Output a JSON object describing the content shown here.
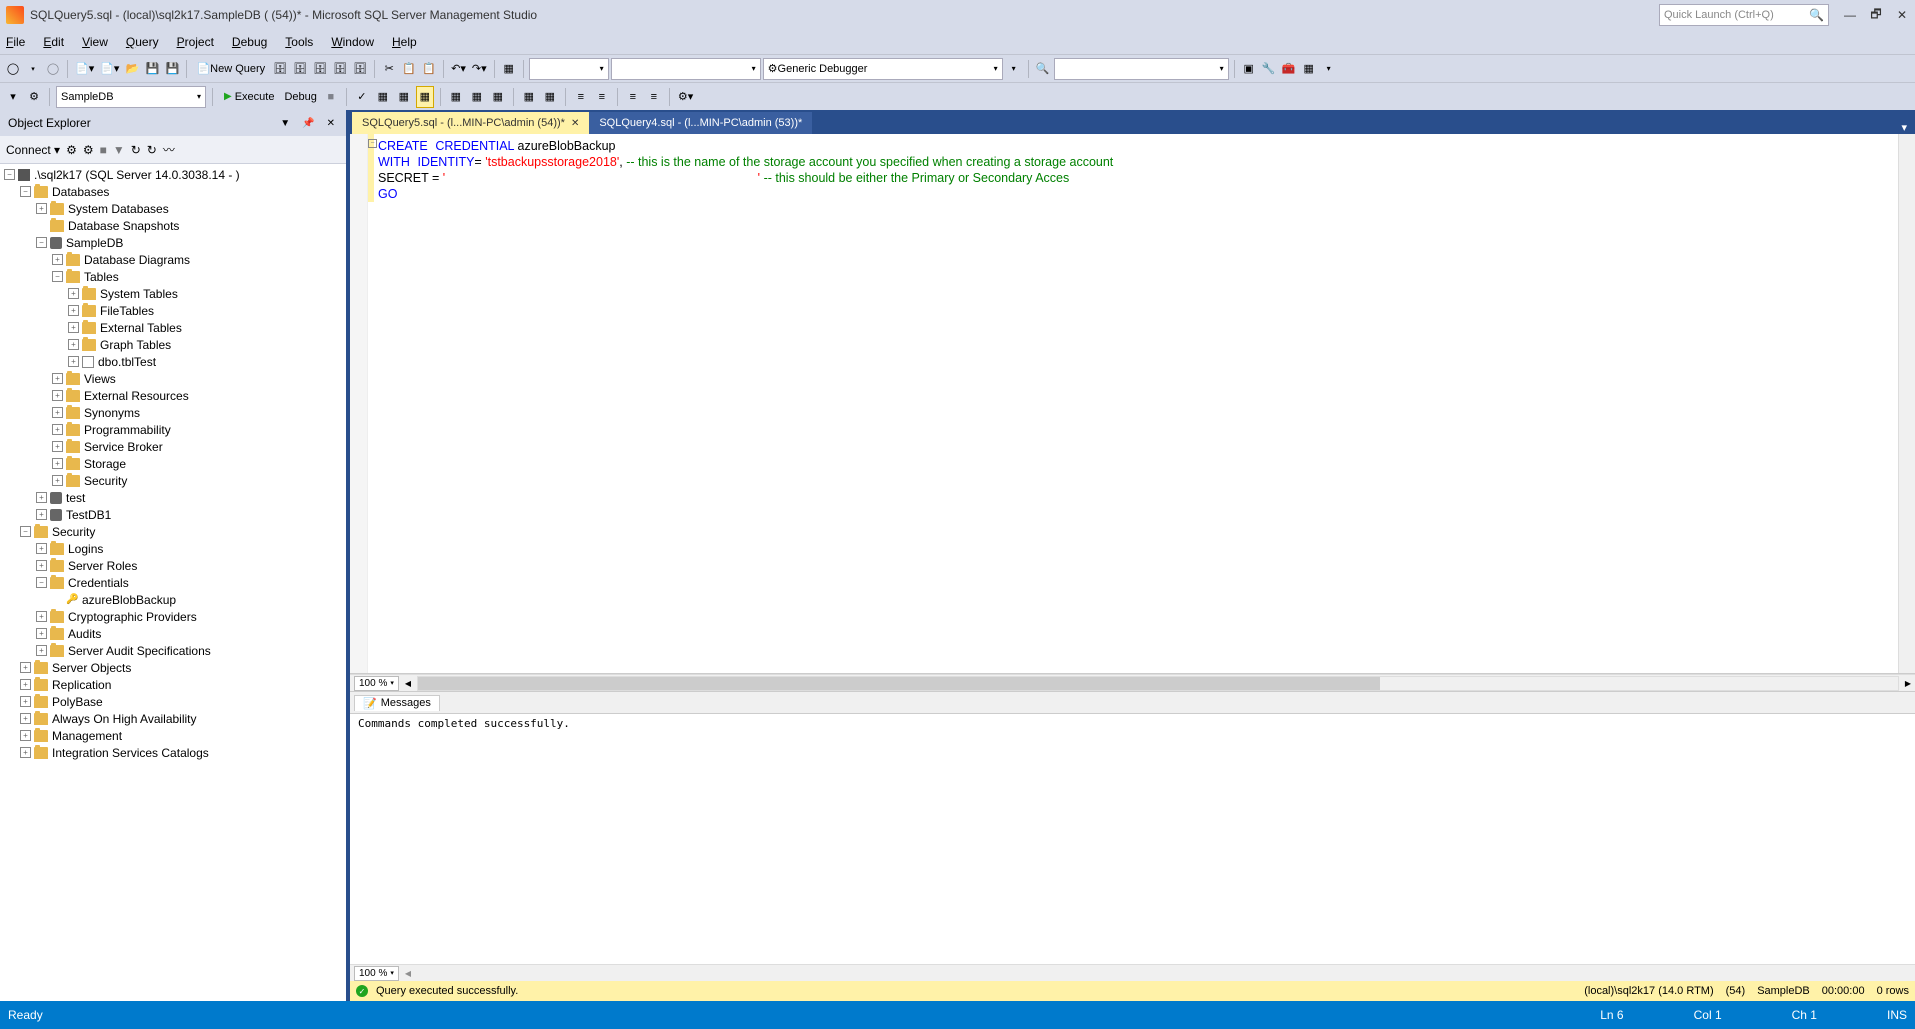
{
  "titlebar": {
    "title": "SQLQuery5.sql - (local)\\sql2k17.SampleDB (           (54))* - Microsoft SQL Server Management Studio",
    "quick_launch_placeholder": "Quick Launch (Ctrl+Q)"
  },
  "menubar": [
    "File",
    "Edit",
    "View",
    "Query",
    "Project",
    "Debug",
    "Tools",
    "Window",
    "Help"
  ],
  "toolbar1": {
    "new_query": "New Query",
    "debugger_combo": "Generic Debugger"
  },
  "toolbar2": {
    "db_combo": "SampleDB",
    "execute": "Execute",
    "debug": "Debug"
  },
  "object_explorer": {
    "title": "Object Explorer",
    "connect": "Connect",
    "root": ".\\sql2k17 (SQL Server 14.0.3038.14 -                        )",
    "tree": [
      {
        "d": 1,
        "t": "-",
        "i": "folder",
        "l": "Databases"
      },
      {
        "d": 2,
        "t": "+",
        "i": "folder",
        "l": "System Databases"
      },
      {
        "d": 2,
        "t": " ",
        "i": "folder",
        "l": "Database Snapshots"
      },
      {
        "d": 2,
        "t": "-",
        "i": "db",
        "l": "SampleDB"
      },
      {
        "d": 3,
        "t": "+",
        "i": "folder",
        "l": "Database Diagrams"
      },
      {
        "d": 3,
        "t": "-",
        "i": "folder",
        "l": "Tables"
      },
      {
        "d": 4,
        "t": "+",
        "i": "folder",
        "l": "System Tables"
      },
      {
        "d": 4,
        "t": "+",
        "i": "folder",
        "l": "FileTables"
      },
      {
        "d": 4,
        "t": "+",
        "i": "folder",
        "l": "External Tables"
      },
      {
        "d": 4,
        "t": "+",
        "i": "folder",
        "l": "Graph Tables"
      },
      {
        "d": 4,
        "t": "+",
        "i": "table",
        "l": "dbo.tblTest"
      },
      {
        "d": 3,
        "t": "+",
        "i": "folder",
        "l": "Views"
      },
      {
        "d": 3,
        "t": "+",
        "i": "folder",
        "l": "External Resources"
      },
      {
        "d": 3,
        "t": "+",
        "i": "folder",
        "l": "Synonyms"
      },
      {
        "d": 3,
        "t": "+",
        "i": "folder",
        "l": "Programmability"
      },
      {
        "d": 3,
        "t": "+",
        "i": "folder",
        "l": "Service Broker"
      },
      {
        "d": 3,
        "t": "+",
        "i": "folder",
        "l": "Storage"
      },
      {
        "d": 3,
        "t": "+",
        "i": "folder",
        "l": "Security"
      },
      {
        "d": 2,
        "t": "+",
        "i": "db",
        "l": "test"
      },
      {
        "d": 2,
        "t": "+",
        "i": "db",
        "l": "TestDB1"
      },
      {
        "d": 1,
        "t": "-",
        "i": "folder",
        "l": "Security"
      },
      {
        "d": 2,
        "t": "+",
        "i": "folder",
        "l": "Logins"
      },
      {
        "d": 2,
        "t": "+",
        "i": "folder",
        "l": "Server Roles"
      },
      {
        "d": 2,
        "t": "-",
        "i": "folder",
        "l": "Credentials"
      },
      {
        "d": 3,
        "t": " ",
        "i": "key",
        "l": "azureBlobBackup"
      },
      {
        "d": 2,
        "t": "+",
        "i": "folder",
        "l": "Cryptographic Providers"
      },
      {
        "d": 2,
        "t": "+",
        "i": "folder",
        "l": "Audits"
      },
      {
        "d": 2,
        "t": "+",
        "i": "folder",
        "l": "Server Audit Specifications"
      },
      {
        "d": 1,
        "t": "+",
        "i": "folder",
        "l": "Server Objects"
      },
      {
        "d": 1,
        "t": "+",
        "i": "folder",
        "l": "Replication"
      },
      {
        "d": 1,
        "t": "+",
        "i": "folder",
        "l": "PolyBase"
      },
      {
        "d": 1,
        "t": "+",
        "i": "folder",
        "l": "Always On High Availability"
      },
      {
        "d": 1,
        "t": "+",
        "i": "folder",
        "l": "Management"
      },
      {
        "d": 1,
        "t": "+",
        "i": "folder",
        "l": "Integration Services Catalogs"
      }
    ]
  },
  "tabs": {
    "active": "SQLQuery5.sql - (l...MIN-PC\\admin (54))*",
    "inactive": "SQLQuery4.sql - (l...MIN-PC\\admin (53))*"
  },
  "code": {
    "l1_kw1": "CREATE",
    "l1_kw2": "CREDENTIAL",
    "l1_ident": " azureBlobBackup",
    "l2_kw1": "WITH",
    "l2_kw2": "IDENTITY",
    "l2_eq": "= ",
    "l2_str": "'tstbackupsstorage2018'",
    "l2_punc": ", ",
    "l2_cmt": "-- this is the name of the storage account you specified when creating a storage account",
    "l3_ident": "SECRET ",
    "l3_eq": "= ",
    "l3_str": "'                                                                                          '",
    "l3_sp": " ",
    "l3_cmt": "-- this should be either the Primary or Secondary Acces",
    "l4": "GO"
  },
  "zoom": "100 %",
  "messages": {
    "tab": "Messages",
    "text": "Commands completed successfully."
  },
  "query_status": {
    "text": "Query executed successfully.",
    "server": "(local)\\sql2k17 (14.0 RTM)",
    "user": "                    (54)",
    "db": "SampleDB",
    "time": "00:00:00",
    "rows": "0 rows"
  },
  "statusbar": {
    "ready": "Ready",
    "ln": "Ln 6",
    "col": "Col 1",
    "ch": "Ch 1",
    "ins": "INS"
  }
}
